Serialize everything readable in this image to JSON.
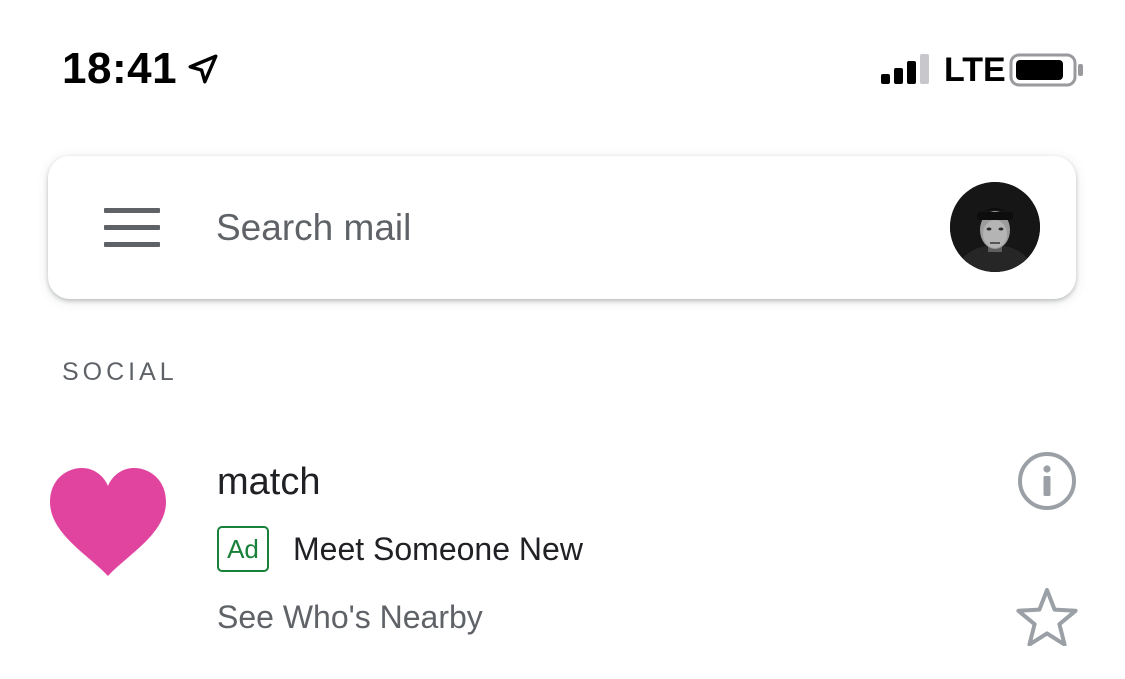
{
  "status_bar": {
    "time": "18:41",
    "location_icon": "location-arrow-icon",
    "signal_icon": "cellular-signal-icon",
    "network": "LTE",
    "battery_icon": "battery-icon"
  },
  "search": {
    "menu_icon": "hamburger-menu-icon",
    "placeholder": "Search mail",
    "avatar": "account-avatar"
  },
  "section": {
    "label": "SOCIAL"
  },
  "mail_item": {
    "logo_icon": "heart-logo-icon",
    "sender": "match",
    "badge": "Ad",
    "subject": "Meet Someone New",
    "snippet": "See Who's Nearby",
    "info_icon": "info-icon",
    "star_icon": "star-outline-icon"
  },
  "colors": {
    "heart": "#e0449f",
    "ad_badge": "#188038",
    "secondary_text": "#5f6368",
    "primary_text": "#202124",
    "icon_gray": "#9aa0a6"
  }
}
